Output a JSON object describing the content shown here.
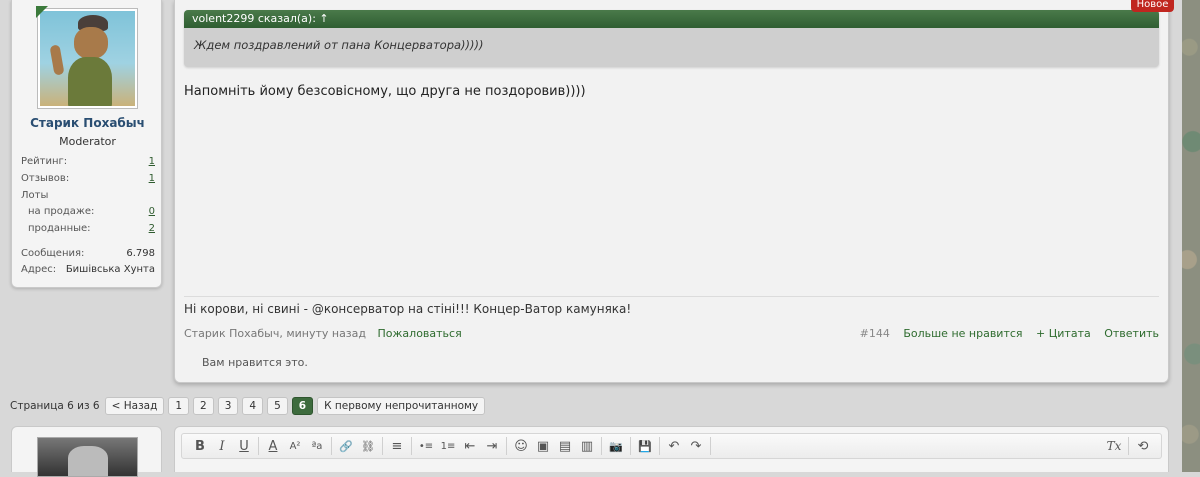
{
  "user": {
    "name": "Старик Похабыч",
    "title": "Moderator",
    "stats": [
      {
        "label": "Рейтинг:",
        "value": "1"
      },
      {
        "label": "Отзывов:",
        "value": "1"
      },
      {
        "label": "Лоты",
        "value": ""
      },
      {
        "label": "на продаже:",
        "value": "0"
      },
      {
        "label": "проданные:",
        "value": "2"
      },
      {
        "label": "Сообщения:",
        "value": "6.798"
      },
      {
        "label": "Адрес:",
        "value": "Бишівська Хунта"
      }
    ]
  },
  "post": {
    "badge": "Новое",
    "quote_author": "volent2299 сказал(а): ↑",
    "quote_text": "Ждем поздравлений от пана Концерватора)))))",
    "message": "Напомніть йому безсовісному, що друга не поздоровив))))",
    "signature": "Ні корови, ні свині - @консерватор на стіні!!! Концер-Ватор камуняка!",
    "meta": "Старик Похабыч, минуту назад",
    "report": "Пожаловаться",
    "number": "#144",
    "unlike": "Больше не нравится",
    "quote_action": "+ Цитата",
    "reply": "Ответить",
    "likes": "Вам нравится это."
  },
  "pager": {
    "label": "Страница 6 из 6",
    "prev": "< Назад",
    "pages": [
      "1",
      "2",
      "3",
      "4",
      "5",
      "6"
    ],
    "current": "6",
    "first_unread": "К первому непрочитанному"
  },
  "toolbar": {
    "bold": "B",
    "italic": "I",
    "underline": "U",
    "font_color": "A",
    "font_size": "A²",
    "font_family": "ªa",
    "link": "🔗",
    "unlink": "⛓",
    "align": "≡",
    "bullet_list": "•≡",
    "number_list": "1≡",
    "outdent": "⇤",
    "indent": "⇥",
    "smilies": "☺",
    "image": "▣",
    "media": "▤",
    "code": "▥",
    "camera": "📷",
    "save": "💾",
    "undo": "↶",
    "redo": "↷",
    "clear_format": "Tx",
    "toggle_bb": "⟲"
  }
}
